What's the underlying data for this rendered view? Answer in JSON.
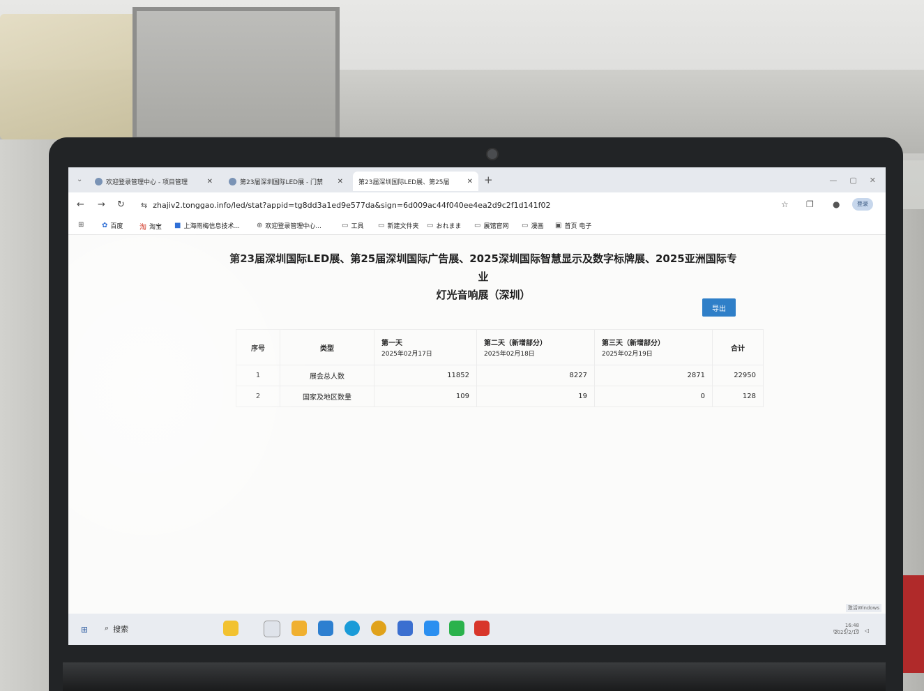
{
  "browser": {
    "tabs": [
      {
        "title": "欢迎登录管理中心 - 项目管理",
        "active": false
      },
      {
        "title": "第23届深圳国际LED展 - 门禁",
        "active": false
      },
      {
        "title": "第23届深圳国际LED展、第25届",
        "active": true
      }
    ],
    "new_tab": "+",
    "url_site_icon": "site-info-icon",
    "url": "zhajiv2.tonggao.info/led/stat?appid=tg8dd3a1ed9e577da&sign=6d009ac44f040ee4ea2d9c2f1d141f02",
    "profile_label": "登录"
  },
  "bookmarks": [
    {
      "label": "百度",
      "icon": "paw-icon"
    },
    {
      "label": "淘宝",
      "icon": "taobao-icon"
    },
    {
      "label": "上海雨梅信息技术...",
      "icon": "bookmark-icon"
    },
    {
      "label": "欢迎登录管理中心...",
      "icon": "globe-icon"
    },
    {
      "label": "工具",
      "icon": "folder-icon"
    },
    {
      "label": "新建文件夹",
      "icon": "folder-icon"
    },
    {
      "label": "おれまま",
      "icon": "folder-icon"
    },
    {
      "label": "展馆官网",
      "icon": "folder-icon"
    },
    {
      "label": "漫画",
      "icon": "folder-icon"
    },
    {
      "label": "首页 电子",
      "icon": "page-icon"
    }
  ],
  "page": {
    "title_line1": "第23届深圳国际LED展、第25届深圳国际广告展、2025深圳国际智慧显示及数字标牌展、2025亚洲国际专业",
    "title_line2": "灯光音响展（深圳）",
    "export_label": "导出"
  },
  "table": {
    "headers": {
      "seq": "序号",
      "type": "类型",
      "day1": "第一天",
      "day1_date": "2025年02月17日",
      "day2": "第二天（新增部分）",
      "day2_date": "2025年02月18日",
      "day3": "第三天（新增部分）",
      "day3_date": "2025年02月19日",
      "total": "合计"
    },
    "rows": [
      {
        "seq": "1",
        "type": "展会总人数",
        "day1": "11852",
        "day2": "8227",
        "day3": "2871",
        "total": "22950"
      },
      {
        "seq": "2",
        "type": "国家及地区数量",
        "day1": "109",
        "day2": "19",
        "day3": "0",
        "total": "128"
      }
    ]
  },
  "taskbar": {
    "search_label": "搜索",
    "clock_time": "16:48",
    "clock_date": "2025/2/19",
    "activation_note": "激活Windows",
    "icons": [
      "start-icon",
      "widgets-icon",
      "task-view-icon",
      "file-explorer-icon",
      "store-icon",
      "edge-icon",
      "chrome-icon",
      "app-icon",
      "feishu-icon",
      "wechat-icon",
      "wps-icon"
    ],
    "colors": {
      "start": "#2c5aa0",
      "edge": "#1a9bd8",
      "chrome": "#e0a21b",
      "wechat": "#2bb24c",
      "wps": "#d8362a"
    }
  }
}
